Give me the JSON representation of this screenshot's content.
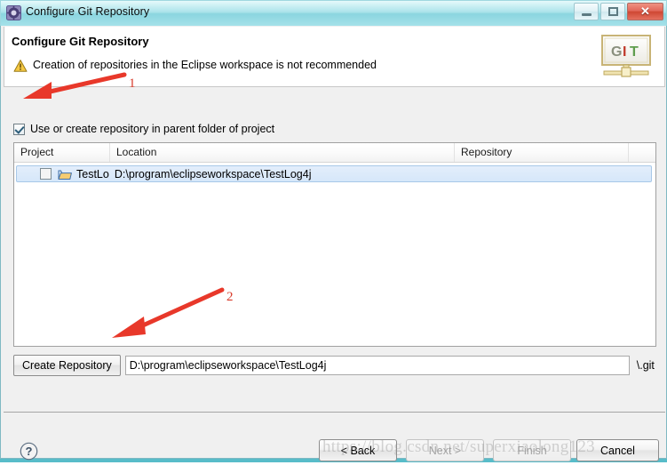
{
  "window": {
    "title": "Configure Git Repository",
    "icon": "eclipse-gear-icon",
    "controls": {
      "minimize": "—",
      "maximize": "□",
      "close": "✕"
    }
  },
  "header": {
    "title": "Configure Git Repository",
    "message": "Creation of repositories in the Eclipse workspace is not recommended",
    "warning_icon": "warning-triangle-icon",
    "logo": {
      "letters": [
        "G",
        "I",
        "T"
      ],
      "colors": [
        "#8a8f7e",
        "#c0392b",
        "#5f9d4e"
      ]
    }
  },
  "main": {
    "parent_folder_checkbox": {
      "label": "Use or create repository in parent folder of project",
      "checked": true
    },
    "table": {
      "columns": [
        "Project",
        "Location",
        "Repository"
      ],
      "rows": [
        {
          "checked": false,
          "icon": "open-folder-icon",
          "project": "TestLo",
          "location": "D:\\program\\eclipseworkspace\\TestLog4j",
          "repository": "",
          "selected": true
        }
      ]
    },
    "create_repository": {
      "button_label": "Create Repository",
      "path_value": "D:\\program\\eclipseworkspace\\TestLog4j",
      "path_placeholder": "",
      "suffix_label": "\\.git"
    }
  },
  "footer": {
    "help_label": "?",
    "buttons": [
      {
        "label": "< Back",
        "enabled": true
      },
      {
        "label": "Next >",
        "enabled": false
      },
      {
        "label": "Finish",
        "enabled": false
      },
      {
        "label": "Cancel",
        "enabled": true
      }
    ]
  },
  "annotations": {
    "accent_color": "#d83a2a",
    "marks": [
      {
        "number": "1",
        "target": "parent-folder-checkbox"
      },
      {
        "number": "2",
        "target": "create-repository-button"
      }
    ]
  },
  "watermark": {
    "text": "https://blog.csdn.net/superxiaolong123"
  }
}
